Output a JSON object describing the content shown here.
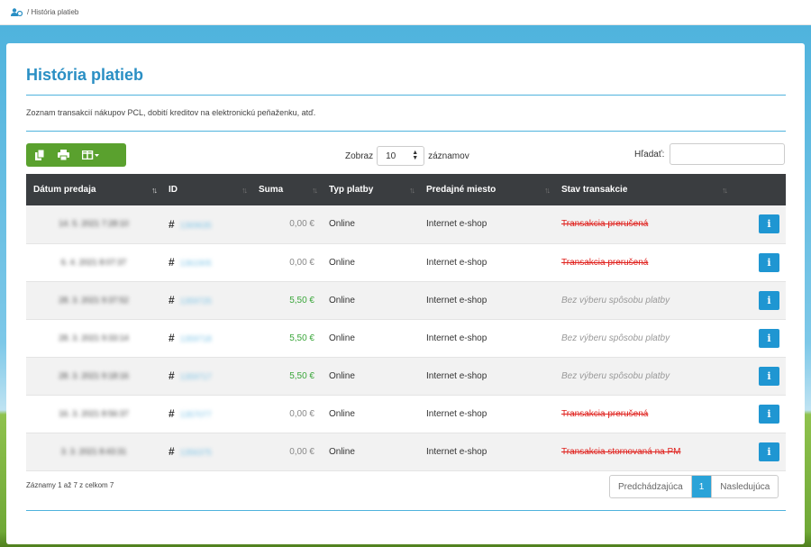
{
  "breadcrumb": {
    "current": "História platieb",
    "separator": "/"
  },
  "page": {
    "title": "História platieb",
    "description": "Zoznam transakcií nákupov PCL, dobití kreditov na elektronickú peňaženku, atď."
  },
  "controls": {
    "length_prefix": "Zobraz",
    "length_value": "10",
    "length_suffix": "záznamov",
    "search_label": "Hľadať:",
    "search_value": ""
  },
  "table": {
    "columns": [
      "Dátum predaja",
      "ID",
      "Suma",
      "Typ platby",
      "Predajné miesto",
      "Stav transakcie"
    ],
    "rows": [
      {
        "date": "14. 5. 2021 7:28:10",
        "id": "1369635",
        "sum": "0,00 €",
        "type": "Online",
        "place": "Internet e-shop",
        "status": "Transakcia prerušená"
      },
      {
        "date": "6. 4. 2021 8:07:37",
        "id": "1361905",
        "sum": "0,00 €",
        "type": "Online",
        "place": "Internet e-shop",
        "status": "Transakcia prerušená"
      },
      {
        "date": "28. 3. 2021 9:37:52",
        "id": "1359725",
        "sum": "5,50 €",
        "type": "Online",
        "place": "Internet e-shop",
        "status": "Bez výberu spôsobu platby"
      },
      {
        "date": "28. 3. 2021 9:33:14",
        "id": "1359718",
        "sum": "5,50 €",
        "type": "Online",
        "place": "Internet e-shop",
        "status": "Bez výberu spôsobu platby"
      },
      {
        "date": "28. 3. 2021 9:18:16",
        "id": "1359717",
        "sum": "5,50 €",
        "type": "Online",
        "place": "Internet e-shop",
        "status": "Bez výberu spôsobu platby"
      },
      {
        "date": "16. 3. 2021 8:56:37",
        "id": "1357077",
        "sum": "0,00 €",
        "type": "Online",
        "place": "Internet e-shop",
        "status": "Transakcia prerušená"
      },
      {
        "date": "3. 3. 2021 8:43:31",
        "id": "1356375",
        "sum": "0,00 €",
        "type": "Online",
        "place": "Internet e-shop",
        "status": "Transakcia stornovaná na PM"
      }
    ]
  },
  "footer": {
    "info": "Záznamy 1 až 7 z celkom 7",
    "prev": "Predchádzajúca",
    "page": "1",
    "next": "Nasledujúca"
  },
  "colors": {
    "accent": "#2a8fc4",
    "toolbar": "#5aa12e",
    "cancel": "#e0221e",
    "positive": "#3aa63a"
  },
  "icons": [
    "user-icon",
    "copy-icon",
    "print-icon",
    "columns-icon",
    "info-icon"
  ]
}
